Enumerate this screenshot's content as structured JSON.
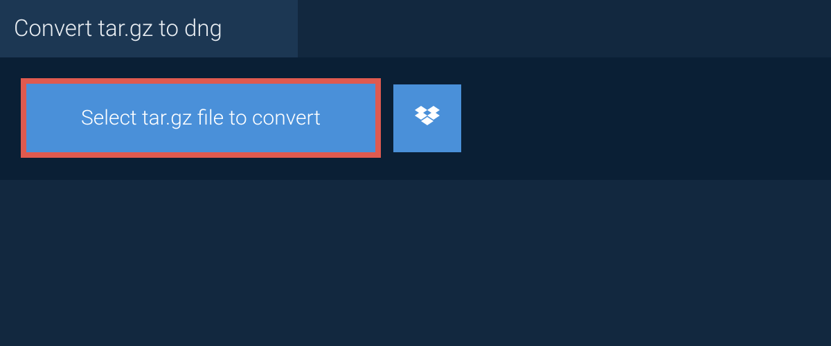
{
  "header": {
    "title": "Convert tar.gz to dng"
  },
  "panel": {
    "select_label": "Select tar.gz file to convert"
  },
  "colors": {
    "background": "#12283f",
    "header_bg": "#1c3753",
    "panel_bg": "#0a1f35",
    "button_bg": "#4a90d9",
    "button_border": "#e05a4f",
    "text_light": "#ffffff"
  }
}
